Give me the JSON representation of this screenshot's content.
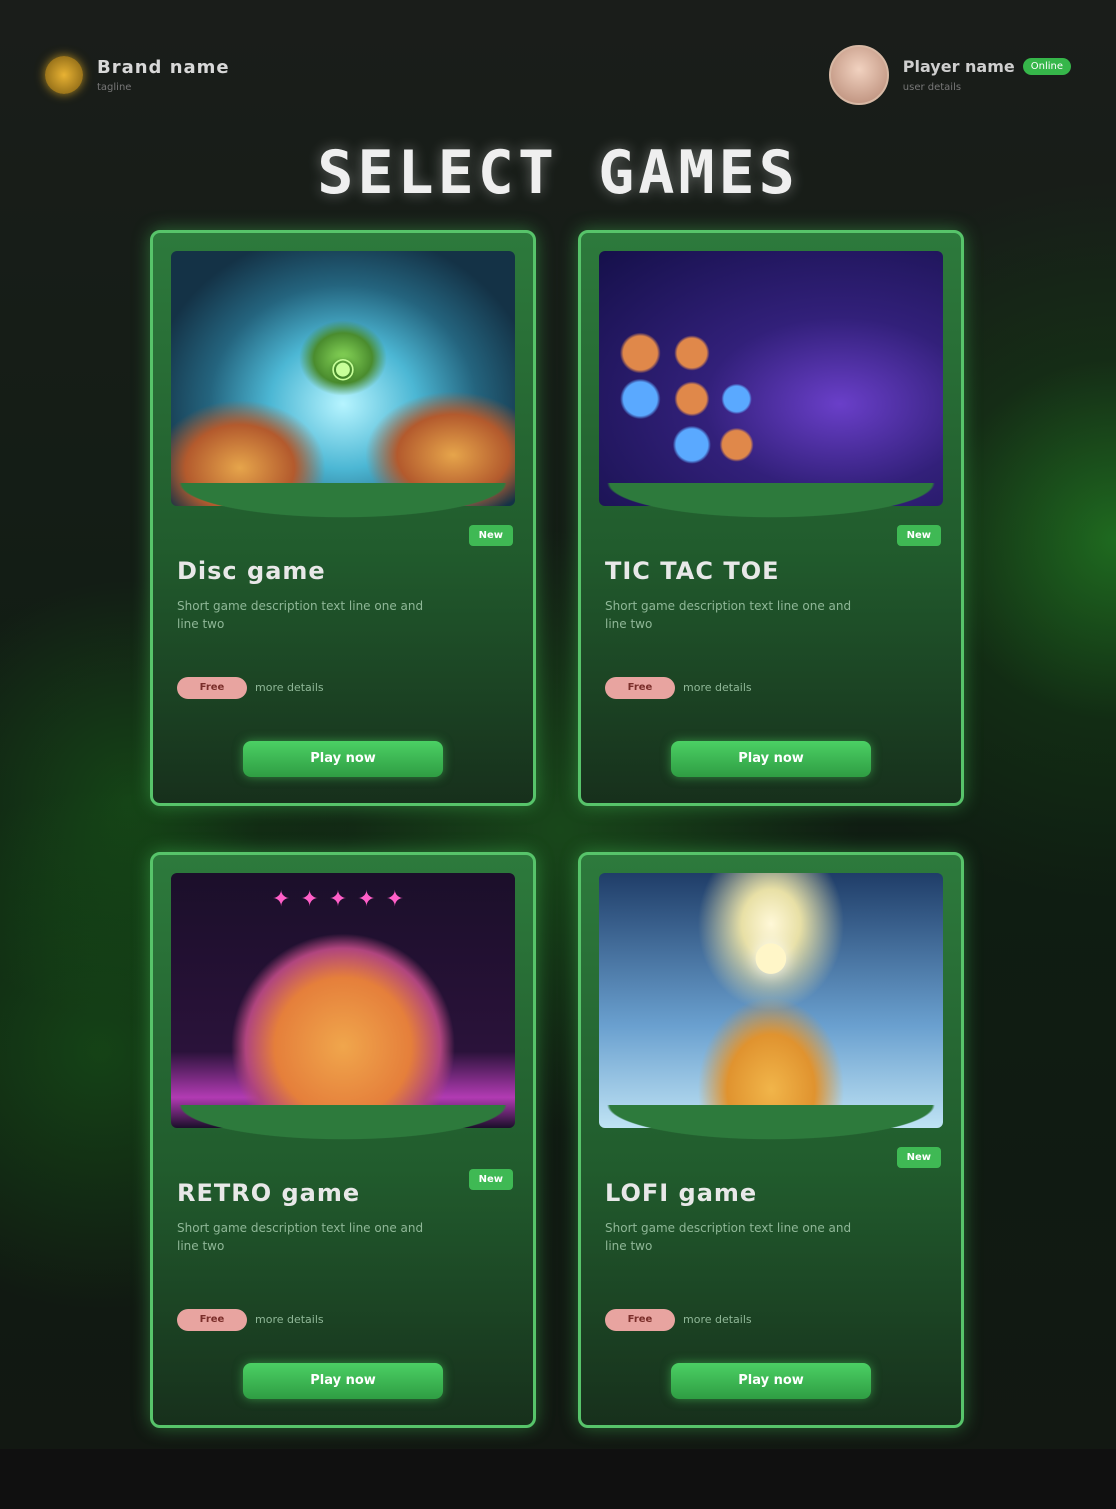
{
  "header": {
    "brand": {
      "name": "Brand name",
      "subtitle": "tagline"
    },
    "user": {
      "name": "Player name",
      "badge": "Online",
      "subtitle": "user details"
    }
  },
  "page_title": "SELECT GAMES",
  "games": [
    {
      "name": "Disc game",
      "tag": "New",
      "description": "Short game description text line one and line two",
      "pill": "Free",
      "meta": "more details",
      "play_label": "Play now",
      "art_icon": "disc-game-art"
    },
    {
      "name": "TIC TAC TOE",
      "tag": "New",
      "description": "Short game description text line one and line two",
      "pill": "Free",
      "meta": "more details",
      "play_label": "Play now",
      "art_icon": "tic-tac-toe-art"
    },
    {
      "name": "RETRO game",
      "tag": "New",
      "description": "Short game description text line one and line two",
      "pill": "Free",
      "meta": "more details",
      "play_label": "Play now",
      "art_icon": "retro-game-art"
    },
    {
      "name": "LOFI game",
      "tag": "New",
      "description": "Short game description text line one and line two",
      "pill": "Free",
      "meta": "more details",
      "play_label": "Play now",
      "art_icon": "lofi-game-art"
    }
  ],
  "colors": {
    "accent": "#3fb954",
    "card_border": "#57c46a",
    "background": "#141814"
  }
}
